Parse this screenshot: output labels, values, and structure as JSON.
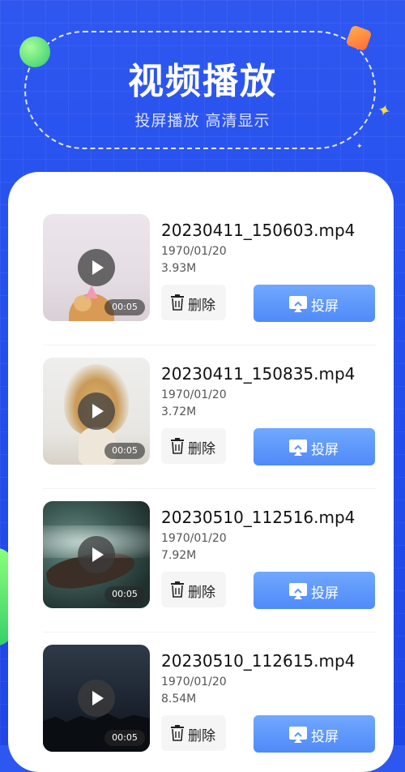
{
  "header": {
    "title": "视频播放",
    "subtitle": "投屏播放 高清显示"
  },
  "videos": [
    {
      "filename": "20230411_150603.mp4",
      "date": "1970/01/20",
      "size": "3.93M",
      "duration": "00:05",
      "delete_label": "删除",
      "cast_label": "投屏"
    },
    {
      "filename": "20230411_150835.mp4",
      "date": "1970/01/20",
      "size": "3.72M",
      "duration": "00:05",
      "delete_label": "删除",
      "cast_label": "投屏"
    },
    {
      "filename": "20230510_112516.mp4",
      "date": "1970/01/20",
      "size": "7.92M",
      "duration": "00:05",
      "delete_label": "删除",
      "cast_label": "投屏"
    },
    {
      "filename": "20230510_112615.mp4",
      "date": "1970/01/20",
      "size": "8.54M",
      "duration": "00:05",
      "delete_label": "删除",
      "cast_label": "投屏"
    }
  ],
  "icons": {
    "play": "play-icon",
    "delete": "trash-icon",
    "cast": "cast-screen-icon"
  },
  "colors": {
    "background": "#2450ee",
    "cast_button": "#5c95fb"
  }
}
